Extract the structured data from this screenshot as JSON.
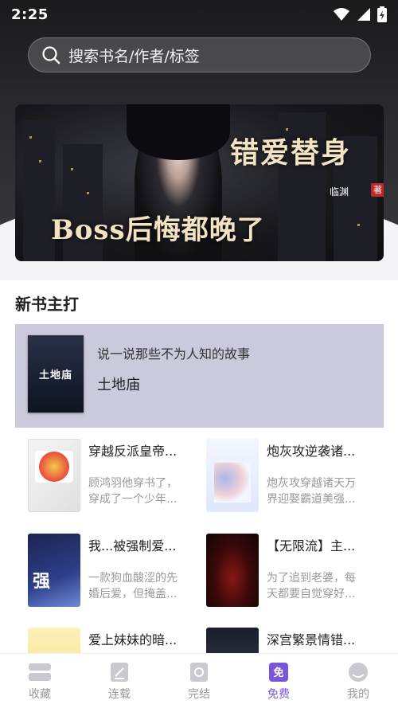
{
  "status": {
    "time": "2:25"
  },
  "search": {
    "placeholder": "搜索书名/作者/标签"
  },
  "banner": {
    "title_line1": "错爱替身",
    "title_line2": "Boss后悔都晚了",
    "author": "临渊",
    "seal": "著"
  },
  "section": {
    "title": "新书主打"
  },
  "featured": {
    "cover_text": "土地庙",
    "description": "说一说那些不为人知的故事",
    "name": "土地庙"
  },
  "books": [
    {
      "title": "穿越反派皇帝...",
      "desc_line1": "顾鸿羽他穿书了，",
      "desc_line2": "穿成了一个少年..."
    },
    {
      "title": "炮灰攻逆袭诸...",
      "desc_line1": "炮灰攻穿越诸天万",
      "desc_line2": "界迎娶霸道美强..."
    },
    {
      "title": "我...被强制爱...",
      "desc_line1": "一款狗血酸涩的先",
      "desc_line2": "婚后爱，但掩盖..."
    },
    {
      "title": "【无限流】主...",
      "desc_line1": "为了追到老婆，每",
      "desc_line2": "天都要自觉穿好..."
    },
    {
      "title": "爱上妹妹的暗...",
      "desc_line1": "",
      "desc_line2": ""
    },
    {
      "title": "深宫繁景情错...",
      "desc_line1": "",
      "desc_line2": ""
    }
  ],
  "tabs": [
    {
      "label": "收藏",
      "icon": "bookshelf-icon"
    },
    {
      "label": "连载",
      "icon": "serial-icon"
    },
    {
      "label": "完结",
      "icon": "finished-icon"
    },
    {
      "label": "免费",
      "icon": "free-icon"
    },
    {
      "label": "我的",
      "icon": "profile-icon"
    }
  ],
  "colors": {
    "accent": "#7a55d8",
    "featured_bg": "#cbc9dc"
  }
}
